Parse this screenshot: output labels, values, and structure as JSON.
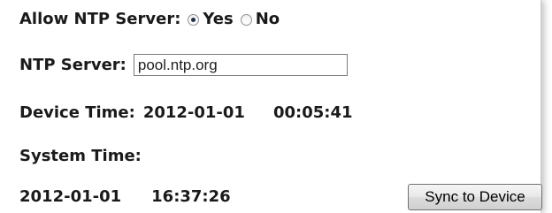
{
  "allow_ntp": {
    "label": "Allow NTP Server:",
    "options": [
      {
        "label": "Yes",
        "selected": true
      },
      {
        "label": "No",
        "selected": false
      }
    ]
  },
  "ntp_server": {
    "label": "NTP Server:",
    "value": "pool.ntp.org"
  },
  "device_time": {
    "label": "Device Time:",
    "date": "2012-01-01",
    "time": "00:05:41"
  },
  "system_time": {
    "label": "System Time:",
    "date": "2012-01-01",
    "time": "16:37:26"
  },
  "sync_button": {
    "label": "Sync to Device"
  },
  "icons": {
    "radio_yes": "radio-button-selected-icon",
    "radio_no": "radio-button-unselected-icon"
  },
  "colors": {
    "text": "#1a1a1a",
    "radio_dot": "#1f2f4f",
    "button_border": "#707070"
  }
}
